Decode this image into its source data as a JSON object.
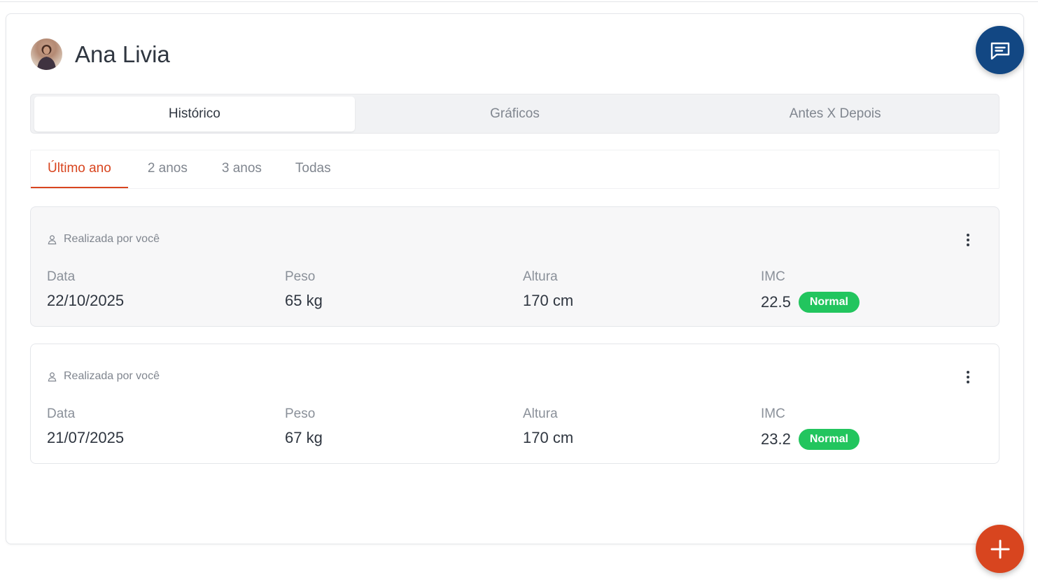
{
  "patient": {
    "name": "Ana Livia"
  },
  "main_tabs": [
    {
      "label": "Histórico",
      "active": true
    },
    {
      "label": "Gráficos",
      "active": false
    },
    {
      "label": "Antes X Depois",
      "active": false
    }
  ],
  "period_tabs": [
    {
      "label": "Último ano",
      "active": true
    },
    {
      "label": "2 anos",
      "active": false
    },
    {
      "label": "3 anos",
      "active": false
    },
    {
      "label": "Todas",
      "active": false
    }
  ],
  "columns": {
    "date": "Data",
    "weight": "Peso",
    "height": "Altura",
    "bmi": "IMC"
  },
  "entries": [
    {
      "author": "Realizada por você",
      "date": "22/10/2025",
      "weight": "65 kg",
      "height": "170 cm",
      "bmi": "22.5",
      "status": "Normal"
    },
    {
      "author": "Realizada por você",
      "date": "21/07/2025",
      "weight": "67 kg",
      "height": "170 cm",
      "bmi": "23.2",
      "status": "Normal"
    }
  ],
  "icons": {
    "chat": "chat-bubble-icon",
    "add": "plus-icon",
    "user": "user-outline-icon",
    "menu": "more-vertical-icon"
  },
  "colors": {
    "accent": "#d8451f",
    "chat_button": "#124783",
    "status_normal": "#22c55e"
  }
}
